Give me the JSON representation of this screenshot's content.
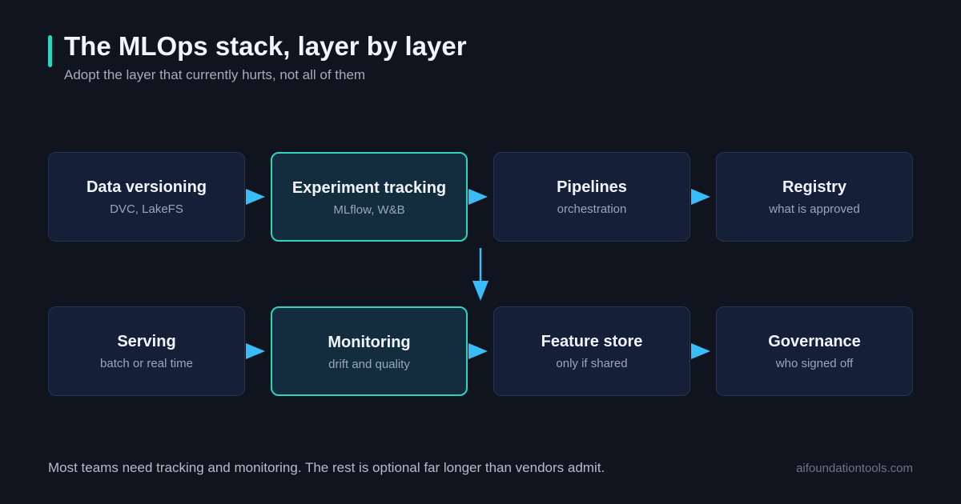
{
  "header": {
    "title": "The MLOps stack, layer by layer",
    "subtitle": "Adopt the layer that currently hurts, not all of them"
  },
  "diagram": {
    "rows": [
      [
        {
          "title": "Data versioning",
          "subtitle": "DVC, LakeFS",
          "highlighted": false
        },
        {
          "title": "Experiment tracking",
          "subtitle": "MLflow, W&B",
          "highlighted": true
        },
        {
          "title": "Pipelines",
          "subtitle": "orchestration",
          "highlighted": false
        },
        {
          "title": "Registry",
          "subtitle": "what is approved",
          "highlighted": false
        }
      ],
      [
        {
          "title": "Serving",
          "subtitle": "batch or real time",
          "highlighted": false
        },
        {
          "title": "Monitoring",
          "subtitle": "drift and quality",
          "highlighted": true
        },
        {
          "title": "Feature store",
          "subtitle": "only if shared",
          "highlighted": false
        },
        {
          "title": "Governance",
          "subtitle": "who signed off",
          "highlighted": false
        }
      ]
    ]
  },
  "footer": {
    "note": "Most teams need tracking and monitoring. The rest is optional far longer than vendors admit.",
    "site": "aifoundationtools.com"
  },
  "colors": {
    "background": "#10141f",
    "accent": "#2dd4bf",
    "arrow": "#38bdf8",
    "node_fill": "#151f38",
    "node_highlight_fill": "#132d3f"
  }
}
